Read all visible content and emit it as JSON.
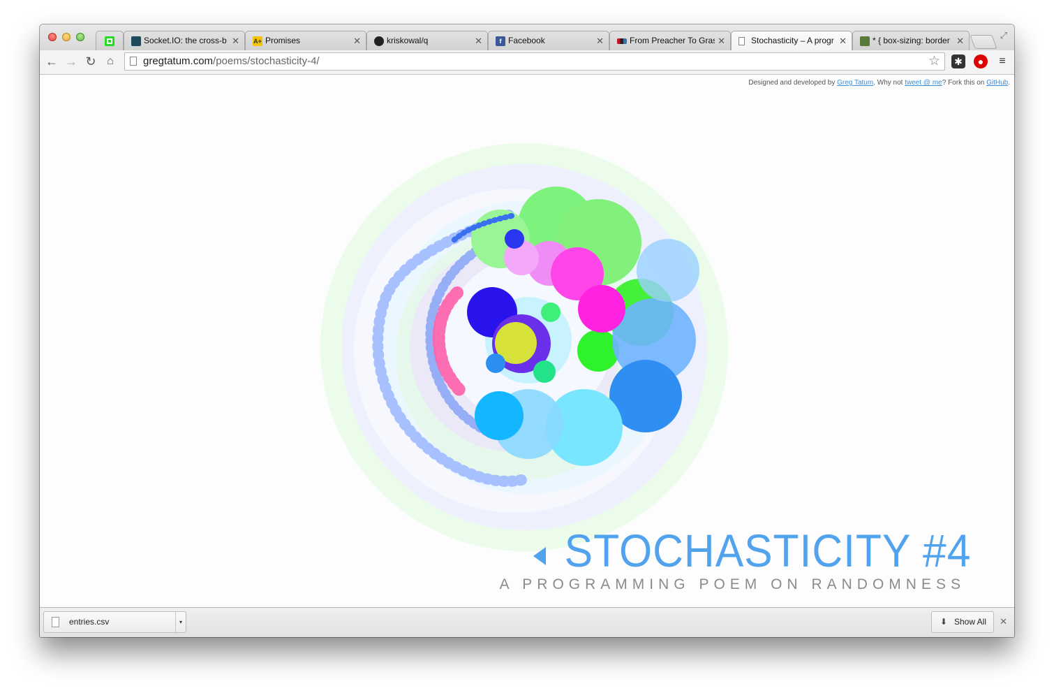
{
  "browser": {
    "tabs": [
      {
        "title": "",
        "favicon": "green-square-icon",
        "color": "#22dd22"
      },
      {
        "title": "Socket.IO: the cross-b",
        "favicon": "socketio-icon",
        "color": "#1d4a5c"
      },
      {
        "title": "Promises",
        "favicon": "aplus-icon",
        "color": "#f5c400",
        "badge": "A+"
      },
      {
        "title": "kriskowal/q",
        "favicon": "github-icon",
        "color": "#222222"
      },
      {
        "title": "Facebook",
        "favicon": "facebook-icon",
        "color": "#3b5998",
        "badge": "f"
      },
      {
        "title": "From Preacher To Gras",
        "favicon": "npr-icon",
        "color": "#c8102e"
      },
      {
        "title": "Stochasticity – A progr",
        "favicon": "page-icon",
        "color": "#ffffff",
        "active": true
      },
      {
        "title": "* { box-sizing: border",
        "favicon": "avatar-icon",
        "color": "#5a7a3a"
      }
    ],
    "url_host": "gregtatum.com",
    "url_path": "/poems/stochasticity-4/"
  },
  "page": {
    "credit": {
      "prefix": "Designed and developed by ",
      "author": "Greg Tatum",
      "mid": ". Why not ",
      "tweet": "tweet @ me",
      "mid2": "? Fork this on ",
      "github": "GitHub",
      "suffix": "."
    },
    "title": "STOCHASTICITY #4",
    "subtitle": "A PROGRAMMING POEM ON RANDOMNESS",
    "accent_color": "#52a3ee"
  },
  "downloads": {
    "file_name": "entries.csv",
    "show_all_label": "Show All"
  }
}
